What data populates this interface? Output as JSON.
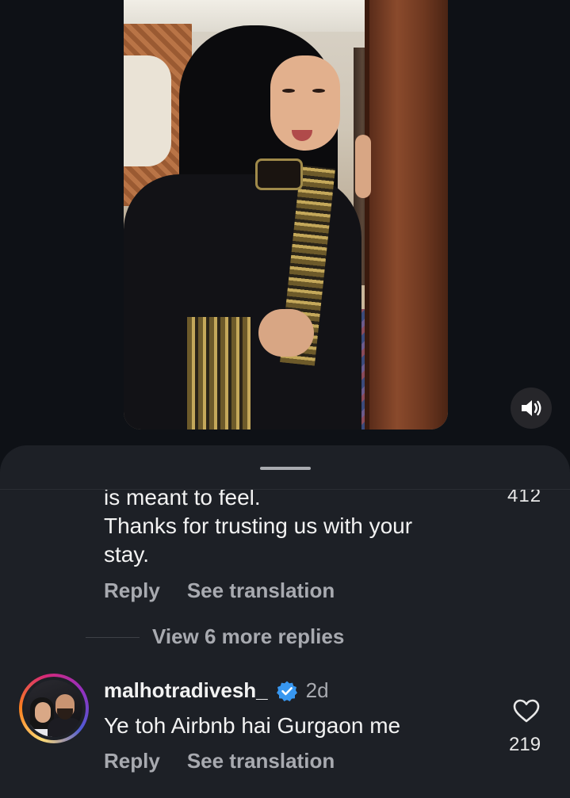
{
  "video": {
    "sound_icon": "speaker-on-icon"
  },
  "comments": {
    "continued_comment": {
      "lines": [
        "is meant to feel.",
        "Thanks for trusting us with your",
        "stay."
      ],
      "partial_like_count": "412",
      "reply_label": "Reply",
      "translate_label": "See translation"
    },
    "view_more_replies": "View 6 more replies",
    "comment": {
      "username": "malhotradivesh_",
      "verified_icon": "verified-badge-icon",
      "time": "2d",
      "text": "Ye toh Airbnb hai Gurgaon me",
      "like_icon": "heart-outline-icon",
      "like_count": "219",
      "reply_label": "Reply",
      "translate_label": "See translation"
    }
  },
  "colors": {
    "background": "#0e1116",
    "sheet": "#1d2026",
    "text_primary": "#f2f2f2",
    "text_secondary": "#a8aab0",
    "verified_blue": "#3897f0"
  }
}
